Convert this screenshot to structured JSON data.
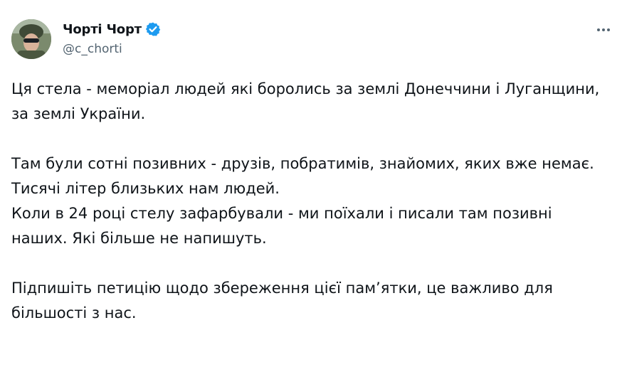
{
  "author": {
    "display_name": "Чорті Чорт",
    "handle": "@c_chorti",
    "verified_color": "#1d9bf0"
  },
  "menu": {
    "more_icon": "more-horizontal-icon"
  },
  "tweet": {
    "paragraphs": [
      "Ця стела - меморіал людей які боролись за землі Донеччини і Луганщини, за землі України.",
      "Там були сотні позивних - друзів, побратимів, знайомих, яких вже немає.\nТисячі літер близьких нам людей.\nКоли в 24 році стелу зафарбували - ми поїхали і писали там позивні наших. Які більше не напишуть.",
      "Підпишіть петицію щодо збереження цієї пам’ятки, це важливо для більшості з нас."
    ]
  }
}
